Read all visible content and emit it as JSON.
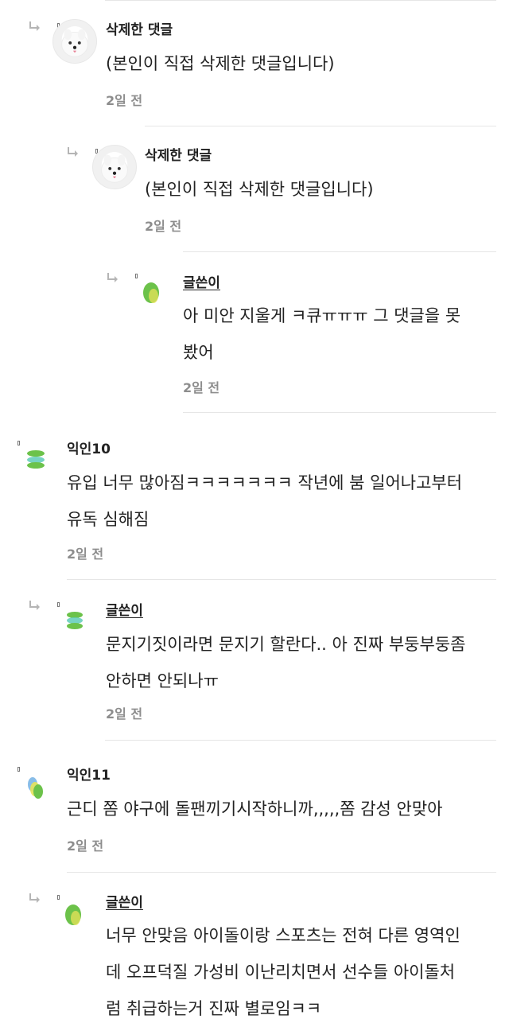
{
  "comments": [
    {
      "name": "삭제한 댓글",
      "text": "(본인이 직접 삭제한 댓글입니다)",
      "time": "2일 전"
    },
    {
      "name": "삭제한 댓글",
      "text": "(본인이 직접 삭제한 댓글입니다)",
      "time": "2일 전"
    },
    {
      "name": "글쓴이",
      "text": "아 미안 지울게 ㅋ큐ㅠㅠㅠ 그 댓글을 못\n봤어",
      "time": "2일 전"
    },
    {
      "name": "익인10",
      "text": "유입 너무 많아짐ㅋㅋㅋㅋㅋㅋㅋ 작년에 붐 일어나고부터\n유독 심해짐",
      "time": "2일 전"
    },
    {
      "name": "글쓴이",
      "text": "문지기짓이라면 문지기 할란다.. 아 진짜 부둥부둥좀\n안하면 안되나ㅠ",
      "time": "2일 전"
    },
    {
      "name": "익인11",
      "text": "근디 쫌 야구에 돌팬끼기시작하니까,,,,,쫌 감성 안맞아",
      "time": "2일 전"
    },
    {
      "name": "글쓴이",
      "text": "너무 안맞음 아이돌이랑 스포츠는 전혀 다른 영역인\n데 오프덕질 가성비 이난리치면서 선수들 아이돌처\n럼 취급하는거 진짜 별로임ㅋㅋ",
      "time": ""
    }
  ],
  "colors": {
    "green": "#6cc24a",
    "teal": "#5ecbb8",
    "yellow": "#e8e35a",
    "blue": "#7bb6e6"
  }
}
